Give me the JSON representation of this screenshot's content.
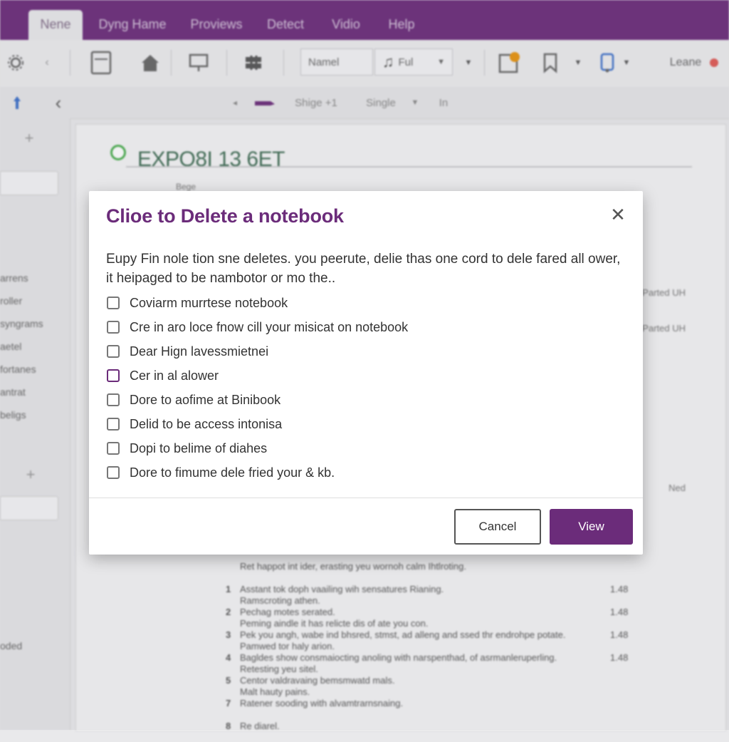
{
  "tabs": [
    {
      "label": "Nene",
      "active": true
    },
    {
      "label": "Dyng Hame",
      "active": false
    },
    {
      "label": "Proviews",
      "active": false
    },
    {
      "label": "Detect",
      "active": false
    },
    {
      "label": "Vidio",
      "active": false
    },
    {
      "label": "Help",
      "active": false
    }
  ],
  "ribbon": {
    "name_field": "Namel",
    "style_field": "Ful",
    "leave_label": "Leane"
  },
  "toolbar2": {
    "text1": "Shige +1",
    "text2": "Single",
    "text3": "In"
  },
  "sidebar": {
    "items": [
      "arrens",
      "roller",
      "syngrams",
      "aetel",
      "fortanes",
      "antrat",
      "beligs"
    ],
    "footer": "oded"
  },
  "page": {
    "title": "EXPO8I 13 6ET",
    "subhead": "Bege",
    "side_notes": [
      "Parted UH",
      "Parted UH",
      "Ned"
    ],
    "list": [
      {
        "num": "",
        "line1": "Ret happot int ider, erasting yeu wornoh calm Ihtlroting.",
        "line2": "",
        "val": ""
      },
      {
        "num": "1",
        "line1": "Asstant tok doph vaailing wih sensatures Rianing.",
        "line2": "Ramscroting athen.",
        "val": "1.48"
      },
      {
        "num": "2",
        "line1": "Pechag motes serated.",
        "line2": "Peming aindle it has relicte dis of ate you con.",
        "val": "1.48"
      },
      {
        "num": "3",
        "line1": "Pek you angh, wabe ind bhsred, stmst, ad alleng and ssed thr endrohpe potate.",
        "line2": "Pamwed tor haly arion.",
        "val": "1.48"
      },
      {
        "num": "4",
        "line1": "Bagldes show consmaiocting anoling with narspenthad, of asrmanleruperling.",
        "line2": "Retesting yeu sitel.",
        "val": "1.48"
      },
      {
        "num": "5",
        "line1": "Centor valdravaing bemsmwatd mals.",
        "line2": "Malt hauty pains.",
        "val": ""
      },
      {
        "num": "7",
        "line1": "Ratener sooding with alvamtrarnsnaing.",
        "line2": "",
        "val": ""
      },
      {
        "num": "8",
        "line1": "Re diarel.",
        "line2": "",
        "val": ""
      }
    ]
  },
  "dialog": {
    "title": "Clioe to Delete a notebook",
    "message": "Eupy Fin nole tion sne deletes. you peerute, delie thas one cord to dele fared all ower, it heipaged to be nambotor or mo the..",
    "options": [
      "Coviarm murrtese notebook",
      "Cre in aro loce fnow cill your misicat on notebook",
      "Dear Hign lavessmietnei",
      "Cer in al alower",
      "Dore to aofime at Binibook",
      "Delid to be access intonisa",
      "Dopi to belime of diahes",
      "Dore to fimume dele fried your & kb."
    ],
    "cancel_label": "Cancel",
    "view_label": "View",
    "close_glyph": "✕"
  },
  "colors": {
    "brand": "#6b2c7a",
    "title_green": "#3d6b52"
  }
}
